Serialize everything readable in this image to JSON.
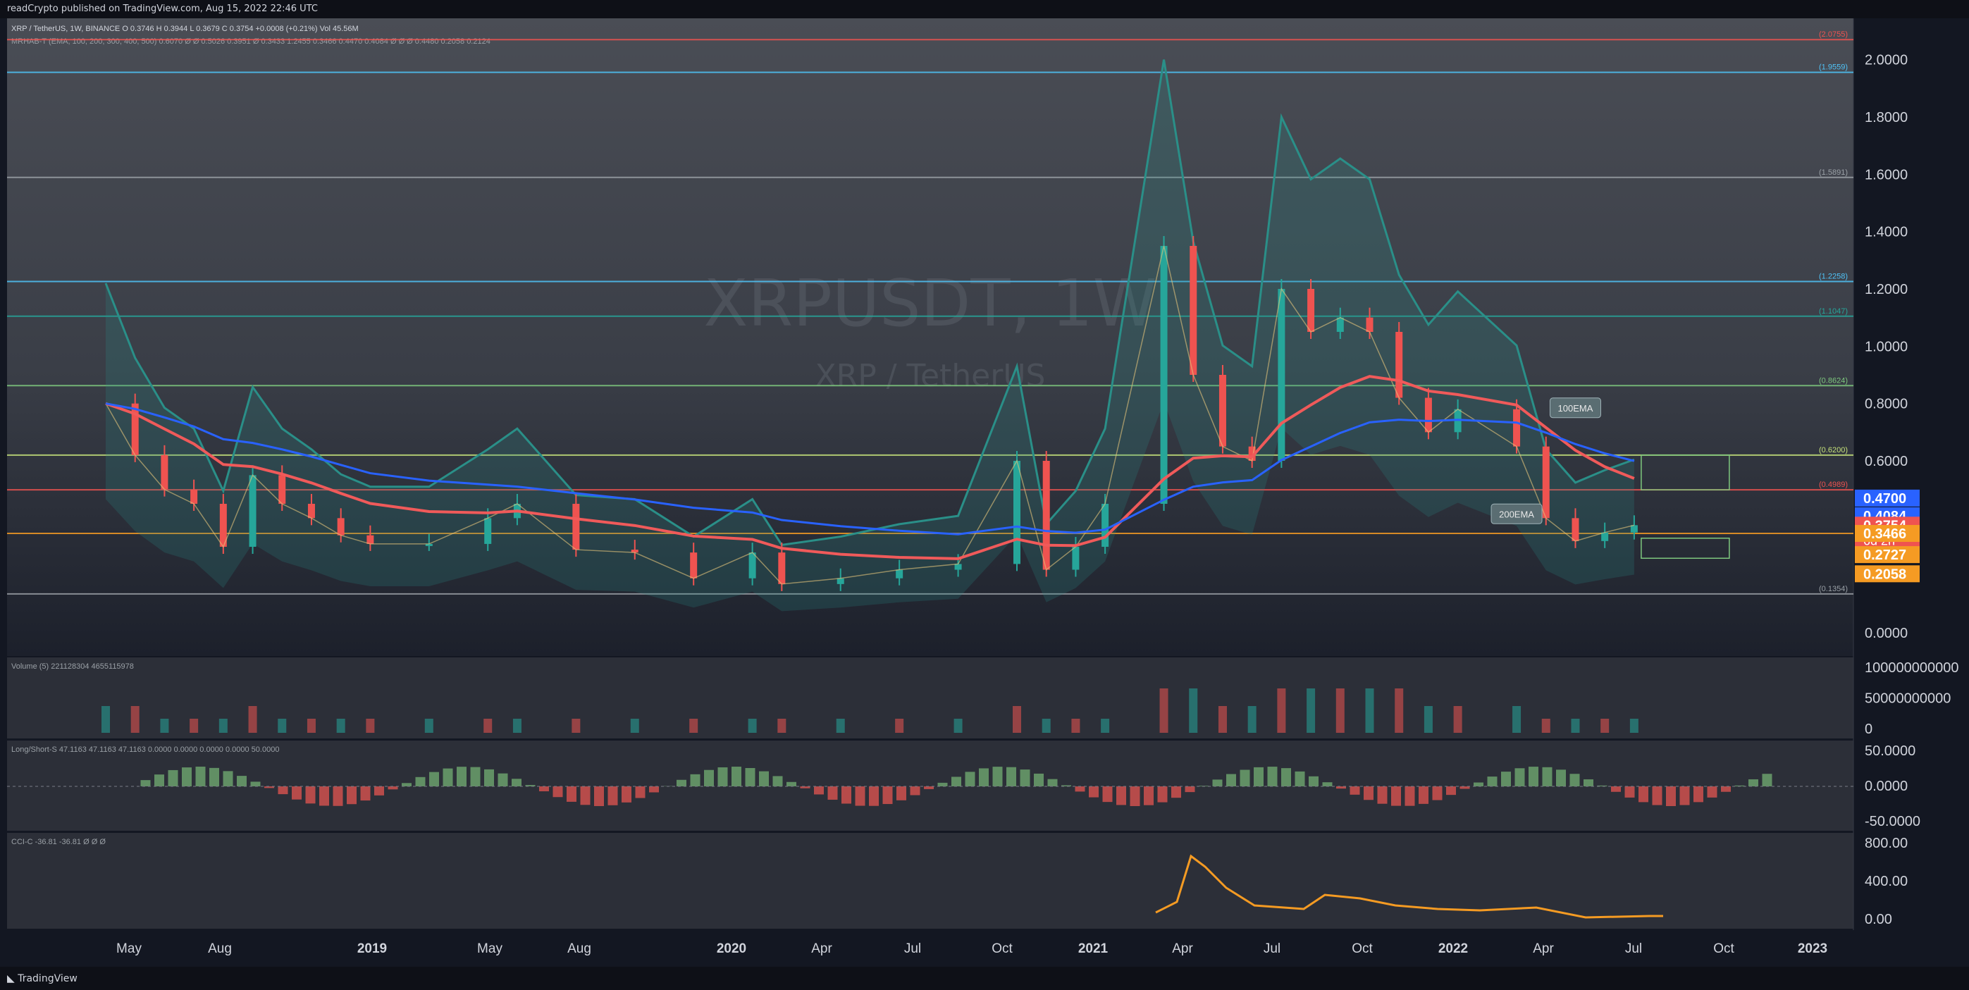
{
  "header": {
    "published": "readCrypto published on TradingView.com, Aug 15, 2022 22:46 UTC",
    "legend_main": "XRP / TetherUS, 1W, BINANCE  O 0.3746  H 0.3944  L 0.3679  C 0.3754  +0.0008 (+0.21%)  Vol 45.56M",
    "legend_ind": "MRHAB-T (EMA, 100, 200, 300, 400, 500)  0.6070  Ø  Ø  0.5026  0.3951  Ø  0.3433  1.2455  0.3466  0.4470  0.4084  Ø  Ø  Ø  0.4480  0.2058  0.2124"
  },
  "watermark": {
    "symbol": "XRPUSDT, 1W",
    "name": "XRP / TetherUS"
  },
  "colors": {
    "background": "#131722",
    "up": "#26a69a",
    "down": "#ef5350",
    "ema100": "#f05a5a",
    "ema200": "#2962ff",
    "bbands": "#2a8f88",
    "level_cyan": "#4fc3f7",
    "level_green": "#7ec87e",
    "level_orange": "#f59b23"
  },
  "chart_data": {
    "type": "candlestick",
    "symbol": "XRPUSDT",
    "timeframe": "1W",
    "exchange": "BINANCE",
    "ylim": [
      0,
      2.1
    ],
    "y_ticks": [
      "0.0000",
      "0.2000",
      "0.4000",
      "0.6000",
      "0.8000",
      "1.0000",
      "1.2000",
      "1.4000",
      "1.6000",
      "1.8000",
      "2.0000"
    ],
    "x_ticks": [
      "May",
      "Aug",
      "2019",
      "May",
      "Aug",
      "2020",
      "Apr",
      "Jul",
      "Oct",
      "2021",
      "Apr",
      "Jul",
      "Oct",
      "2022",
      "Apr",
      "Jul",
      "Oct",
      "2023"
    ],
    "close_series": [
      {
        "t": "2018-04",
        "v": 0.8
      },
      {
        "t": "2018-05",
        "v": 0.62
      },
      {
        "t": "2018-06",
        "v": 0.5
      },
      {
        "t": "2018-07",
        "v": 0.45
      },
      {
        "t": "2018-08",
        "v": 0.3
      },
      {
        "t": "2018-09",
        "v": 0.55
      },
      {
        "t": "2018-10",
        "v": 0.45
      },
      {
        "t": "2018-11",
        "v": 0.4
      },
      {
        "t": "2018-12",
        "v": 0.34
      },
      {
        "t": "2019-01",
        "v": 0.31
      },
      {
        "t": "2019-03",
        "v": 0.31
      },
      {
        "t": "2019-05",
        "v": 0.4
      },
      {
        "t": "2019-06",
        "v": 0.45
      },
      {
        "t": "2019-08",
        "v": 0.29
      },
      {
        "t": "2019-10",
        "v": 0.28
      },
      {
        "t": "2019-12",
        "v": 0.19
      },
      {
        "t": "2020-02",
        "v": 0.28
      },
      {
        "t": "2020-03",
        "v": 0.17
      },
      {
        "t": "2020-05",
        "v": 0.19
      },
      {
        "t": "2020-07",
        "v": 0.22
      },
      {
        "t": "2020-09",
        "v": 0.24
      },
      {
        "t": "2020-11",
        "v": 0.6
      },
      {
        "t": "2020-12",
        "v": 0.22
      },
      {
        "t": "2021-01",
        "v": 0.3
      },
      {
        "t": "2021-02",
        "v": 0.45
      },
      {
        "t": "2021-04",
        "v": 1.35
      },
      {
        "t": "2021-05",
        "v": 0.9
      },
      {
        "t": "2021-06",
        "v": 0.65
      },
      {
        "t": "2021-07",
        "v": 0.6
      },
      {
        "t": "2021-08",
        "v": 1.2
      },
      {
        "t": "2021-09",
        "v": 1.05
      },
      {
        "t": "2021-10",
        "v": 1.1
      },
      {
        "t": "2021-11",
        "v": 1.05
      },
      {
        "t": "2021-12",
        "v": 0.82
      },
      {
        "t": "2022-01",
        "v": 0.7
      },
      {
        "t": "2022-02",
        "v": 0.78
      },
      {
        "t": "2022-04",
        "v": 0.65
      },
      {
        "t": "2022-05",
        "v": 0.4
      },
      {
        "t": "2022-06",
        "v": 0.32
      },
      {
        "t": "2022-07",
        "v": 0.35
      },
      {
        "t": "2022-08",
        "v": 0.3754
      }
    ],
    "price_labels": [
      {
        "value": 0.47,
        "text": "0.4700",
        "color": "#2962ff"
      },
      {
        "value": 0.4084,
        "text": "0.4084",
        "color": "#2962ff"
      },
      {
        "value": 0.3754,
        "text": "0.3754",
        "sub": "6d 2h",
        "color": "#ef5350"
      },
      {
        "value": 0.3466,
        "text": "0.3466",
        "color": "#f59b23"
      },
      {
        "value": 0.2727,
        "text": "0.2727",
        "color": "#f59b23"
      },
      {
        "value": 0.2058,
        "text": "0.2058",
        "color": "#f59b23"
      }
    ],
    "levels": [
      {
        "value": 2.07,
        "label": "(2.0755)",
        "color": "#ef5350"
      },
      {
        "value": 1.9559,
        "label": "(1.9559)",
        "color": "#4fc3f7"
      },
      {
        "value": 1.5891,
        "label": "(1.5891)",
        "color": "#9aa0a6"
      },
      {
        "value": 1.2258,
        "label": "(1.2258)",
        "color": "#4fc3f7"
      },
      {
        "value": 1.1047,
        "label": "(1.1047)",
        "color": "#26a69a"
      },
      {
        "value": 0.8624,
        "label": "(0.8624)",
        "color": "#7ec87e"
      },
      {
        "value": 0.62,
        "label": "(0.6200)",
        "color": "#c6e27a"
      },
      {
        "value": 0.4989,
        "label": "(0.4989)",
        "color": "#ef5350"
      },
      {
        "value": 0.3466,
        "label": "",
        "color": "#f59b23"
      },
      {
        "value": 0.1354,
        "label": "(0.1354)",
        "color": "#9aa0a6"
      }
    ],
    "annotations": [
      {
        "text": "100EMA",
        "date": "2022-06",
        "value": 0.78
      },
      {
        "text": "200EMA",
        "date": "2022-04",
        "value": 0.41
      }
    ],
    "panes": [
      {
        "name": "Volume (5)",
        "header": "Volume (5)  221128304  4655115978",
        "y_ticks": [
          "0",
          "50000000000",
          "100000000000"
        ]
      },
      {
        "name": "Long/Short-S",
        "header": "Long/Short-S  47.1163  47.1163  47.1163  0.0000  0.0000  0.0000  0.0000  50.0000",
        "y_ticks": [
          "-50.0000",
          "0.0000",
          "50.0000"
        ]
      },
      {
        "name": "CCI-C",
        "header": "CCI-C  -36.81  -36.81  Ø  Ø  Ø",
        "y_ticks": [
          "0.00",
          "400.00",
          "800.00"
        ]
      }
    ]
  },
  "footer": {
    "brand": "TradingView"
  }
}
